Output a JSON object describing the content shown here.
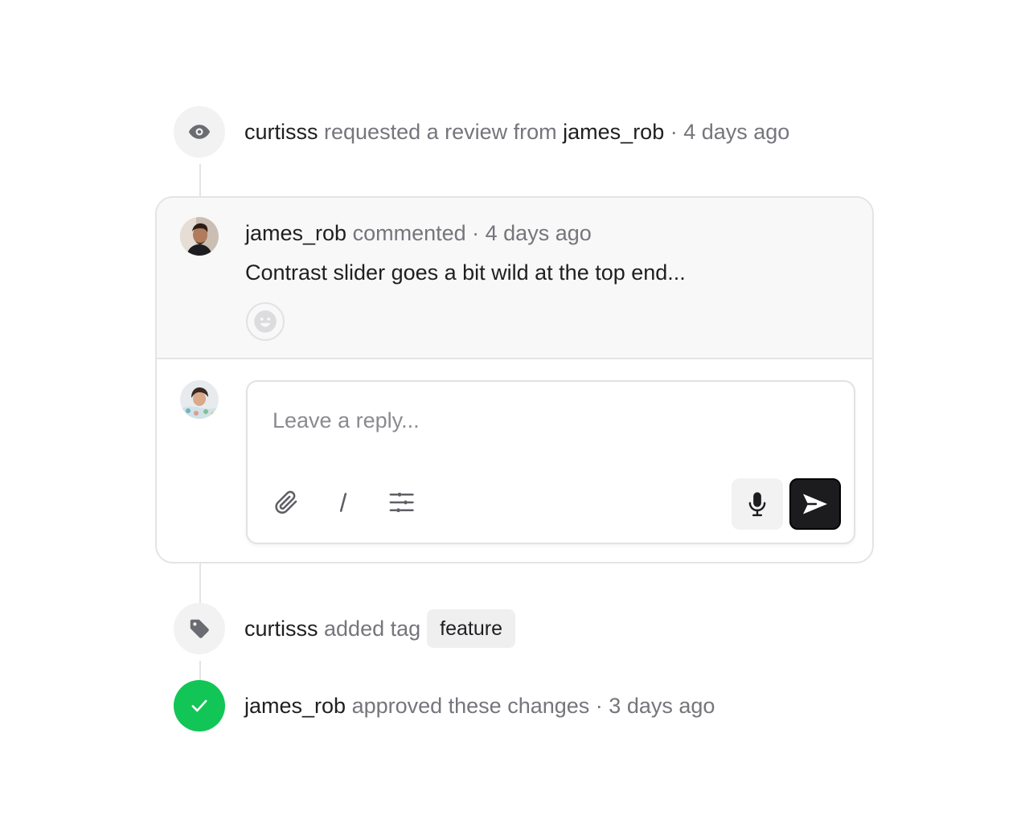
{
  "timeline": {
    "review_event": {
      "actor": "curtisss",
      "action": " requested a review from ",
      "target": "james_rob",
      "separator": " · ",
      "time": "4 days ago"
    },
    "comment": {
      "author": "james_rob",
      "action": " commented",
      "separator": " · ",
      "time": "4 days ago",
      "body": "Contrast slider goes a bit wild at the top end..."
    },
    "reply": {
      "placeholder": "Leave a reply..."
    },
    "tag_event": {
      "actor": "curtisss",
      "action": " added tag",
      "tag": "feature"
    },
    "approve_event": {
      "actor": "james_rob",
      "action": " approved these changes",
      "separator": " · ",
      "time": "3 days ago"
    }
  },
  "icons": {
    "review": "eye-icon",
    "reaction": "smiley-icon",
    "attach": "paperclip-icon",
    "command": "slash-icon",
    "options": "sliders-icon",
    "voice": "microphone-icon",
    "send": "send-icon",
    "tag": "tag-icon",
    "approve": "check-icon"
  },
  "colors": {
    "approve_green": "#12c557",
    "send_button": "#1c1c1e"
  }
}
